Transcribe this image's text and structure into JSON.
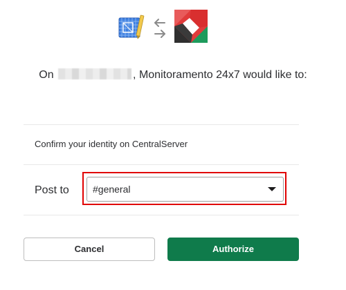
{
  "header": {
    "left_app_icon": "blueprint-app-icon",
    "swap_icon": "swap-arrows-icon",
    "right_app_icon": "slack-app-icon"
  },
  "message": {
    "prefix": "On",
    "suffix": ", Monitoramento 24x7 would like to:"
  },
  "permissions": {
    "identity": "Confirm your identity on CentralServer"
  },
  "post_to": {
    "label": "Post to",
    "selected_channel": "#general"
  },
  "actions": {
    "cancel_label": "Cancel",
    "authorize_label": "Authorize"
  },
  "colors": {
    "authorize_bg": "#0f7b4b",
    "highlight_border": "#e00000"
  }
}
